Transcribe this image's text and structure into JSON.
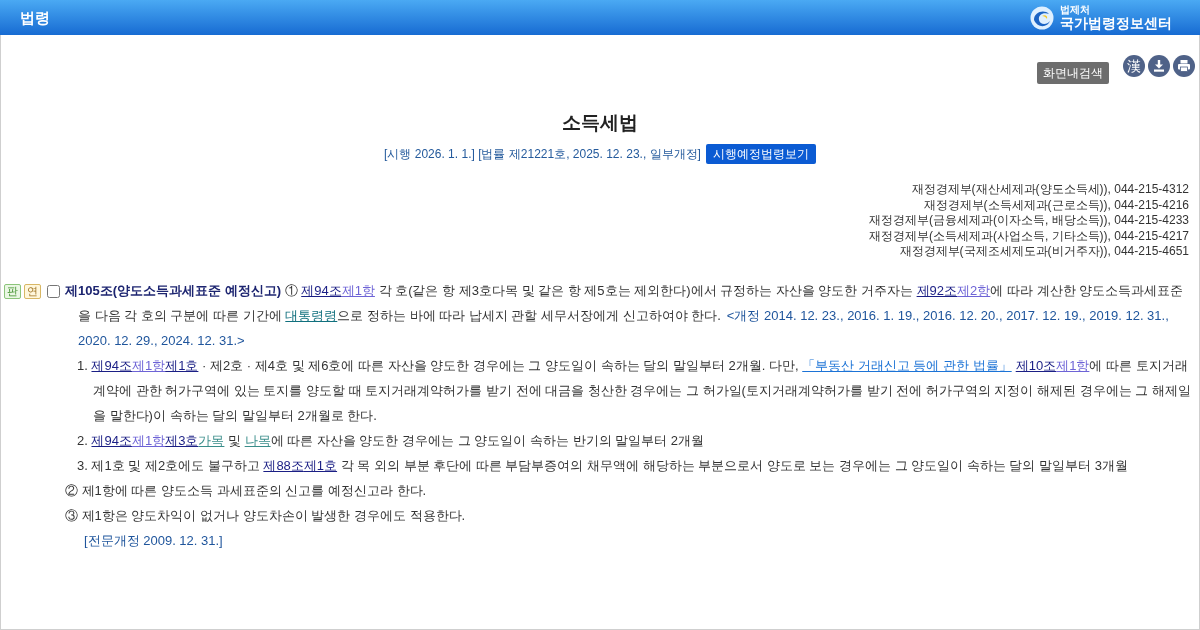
{
  "header": {
    "title": "법령",
    "logo_caption": "법제처",
    "logo_title": "국가법령정보센터"
  },
  "toolbar": {
    "search_button": "화면내검색",
    "icons": [
      {
        "kind": "hanja",
        "label": "漢"
      },
      {
        "kind": "download"
      },
      {
        "kind": "print"
      }
    ]
  },
  "law": {
    "title": "소득세법",
    "enforcement": "[시행 2026. 1. 1.] [법률 제21221호, 2025. 12. 23., 일부개정]",
    "future_button": "시행예정법령보기"
  },
  "contacts": [
    "재정경제부(재산세제과(양도소득세)), 044-215-4312",
    "재정경제부(소득세제과(근로소득)), 044-215-4216",
    "재정경제부(금융세제과(이자소득, 배당소득)), 044-215-4233",
    "재정경제부(소득세제과(사업소득, 기타소득)), 044-215-4217",
    "재정경제부(국제조세제도과(비거주자)), 044-215-4651"
  ],
  "article": {
    "tags": [
      {
        "kind": "case",
        "label": "판"
      },
      {
        "kind": "history",
        "label": "연"
      }
    ],
    "checkbox": {
      "checked": false
    },
    "paragraphs": [
      {
        "kind": "lead",
        "segments": [
          {
            "kind": "title",
            "text": "제105조(양도소득과세표준 예정신고)"
          },
          {
            "kind": "text",
            "text": " ① "
          },
          {
            "kind": "article_link",
            "text": "제94조"
          },
          {
            "kind": "clause_link",
            "text": "제1항"
          },
          {
            "kind": "text",
            "text": " 각 호(같은 항 제3호다목 및 같은 항 제5호는 제외한다)에서 규정하는 자산을 양도한 거주자는 "
          },
          {
            "kind": "article_link",
            "text": "제92조"
          },
          {
            "kind": "clause_link",
            "text": "제2항"
          },
          {
            "kind": "text",
            "text": "에 따라 계산한 양도소득과세표준을 다음 각 호의 구분에 따른 기간에 "
          },
          {
            "kind": "decree_link",
            "text": "대통령령"
          },
          {
            "kind": "text",
            "text": "으로 정하는 바에 따라 납세지 관할 세무서장에게 신고하여야 한다."
          },
          {
            "kind": "note",
            "text": "<개정 2014. 12. 23., 2016. 1. 19., 2016. 12. 20., 2017. 12. 19., 2019. 12. 31., 2020. 12. 29., 2024. 12. 31.>"
          }
        ]
      },
      {
        "kind": "item",
        "segments": [
          {
            "kind": "text",
            "text": "1. "
          },
          {
            "kind": "article_link",
            "text": "제94조"
          },
          {
            "kind": "clause_link",
            "text": "제1항"
          },
          {
            "kind": "item_link",
            "text": "제1호"
          },
          {
            "kind": "text",
            "text": " · 제2호 · 제4호 및 제6호에 따른 자산을 양도한 경우에는 그 양도일이 속하는 달의 말일부터 2개월. 다만, "
          },
          {
            "kind": "act_link",
            "text": "「부동산 거래신고 등에 관한 법률」"
          },
          {
            "kind": "article_link",
            "text": "제10조"
          },
          {
            "kind": "clause_link",
            "text": "제1항"
          },
          {
            "kind": "text",
            "text": "에 따른 토지거래계약에 관한 허가구역에 있는 토지를 양도할 때 토지거래계약허가를 받기 전에 대금을 청산한 경우에는 그 허가일(토지거래계약허가를 받기 전에 허가구역의 지정이 해제된 경우에는 그 해제일을 말한다)이 속하는 달의 말일부터 2개월로 한다."
          }
        ]
      },
      {
        "kind": "item",
        "segments": [
          {
            "kind": "text",
            "text": "2. "
          },
          {
            "kind": "article_link",
            "text": "제94조"
          },
          {
            "kind": "clause_link",
            "text": "제1항"
          },
          {
            "kind": "item_link",
            "text": "제3호"
          },
          {
            "kind": "sub_item_link",
            "text": "가목"
          },
          {
            "kind": "text",
            "text": " 및 "
          },
          {
            "kind": "sub_item_link",
            "text": "나목"
          },
          {
            "kind": "text",
            "text": "에 따른 자산을 양도한 경우에는 그 양도일이 속하는 반기의 말일부터 2개월"
          }
        ]
      },
      {
        "kind": "item",
        "segments": [
          {
            "kind": "text",
            "text": "3. 제1호 및 제2호에도 불구하고 "
          },
          {
            "kind": "article_link",
            "text": "제88조"
          },
          {
            "kind": "item_link",
            "text": "제1호"
          },
          {
            "kind": "text",
            "text": " 각 목 외의 부분 후단에 따른 부담부증여의 채무액에 해당하는 부분으로서 양도로 보는 경우에는 그 양도일이 속하는 달의 말일부터 3개월"
          }
        ]
      },
      {
        "kind": "paragraph",
        "segments": [
          {
            "kind": "text",
            "text": "② 제1항에 따른 양도소득 과세표준의 신고를 예정신고라 한다."
          }
        ]
      },
      {
        "kind": "paragraph",
        "segments": [
          {
            "kind": "text",
            "text": "③ 제1항은 양도차익이 없거나 양도차손이 발생한 경우에도 적용한다."
          }
        ]
      },
      {
        "kind": "footnote",
        "segments": [
          {
            "kind": "note",
            "text": "[전문개정 2009. 12. 31.]"
          }
        ]
      }
    ]
  }
}
